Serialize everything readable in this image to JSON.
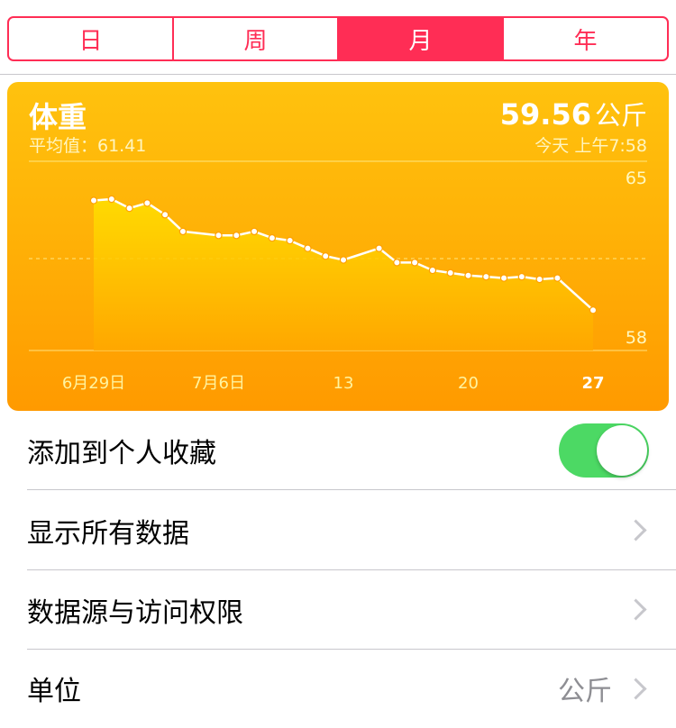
{
  "segments": [
    {
      "label": "日",
      "active": false
    },
    {
      "label": "周",
      "active": false
    },
    {
      "label": "月",
      "active": true
    },
    {
      "label": "年",
      "active": false
    }
  ],
  "card": {
    "title": "体重",
    "average": "平均值：61.41",
    "value": "59.56",
    "unit": "公斤",
    "timestamp": "今天 上午7:58"
  },
  "chart_data": {
    "type": "area",
    "x": [
      1,
      2,
      3,
      4,
      5,
      6,
      8,
      9,
      10,
      11,
      12,
      13,
      14,
      15,
      17,
      18,
      19,
      20,
      21,
      22,
      23,
      24,
      25,
      26,
      27,
      29
    ],
    "values": [
      63.8,
      63.85,
      63.5,
      63.7,
      63.25,
      62.6,
      62.45,
      62.45,
      62.6,
      62.35,
      62.25,
      61.95,
      61.65,
      61.5,
      61.95,
      61.4,
      61.4,
      61.1,
      61.0,
      60.9,
      60.85,
      60.8,
      60.85,
      60.75,
      60.8,
      59.56
    ],
    "ylim": [
      58,
      65
    ],
    "yticks": [
      "65",
      "58"
    ],
    "xtick_labels": [
      "6月29日",
      "7月6日",
      "13",
      "20",
      "27"
    ],
    "xtick_positions": [
      1,
      8,
      15,
      22,
      29
    ],
    "colors": {
      "line": "#ffffff",
      "fill_top": "#ffe000",
      "fill_bottom": "#ffa800"
    }
  },
  "rows": [
    {
      "label": "添加到个人收藏",
      "toggle": true
    },
    {
      "label": "显示所有数据"
    },
    {
      "label": "数据源与访问权限"
    },
    {
      "label": "单位",
      "detail": "公斤"
    }
  ]
}
